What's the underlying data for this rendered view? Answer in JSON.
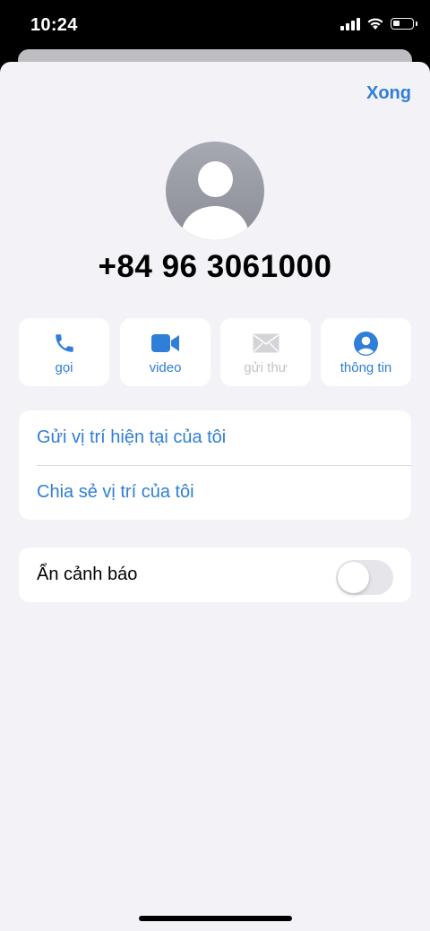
{
  "status_bar": {
    "time": "10:24"
  },
  "header": {
    "done_label": "Xong"
  },
  "contact": {
    "phone_number": "+84 96 3061000"
  },
  "actions": [
    {
      "label": "gọi",
      "icon": "phone-icon",
      "enabled": true
    },
    {
      "label": "video",
      "icon": "video-camera-icon",
      "enabled": true
    },
    {
      "label": "gửi thư",
      "icon": "mail-icon",
      "enabled": false
    },
    {
      "label": "thông tin",
      "icon": "person-circle-icon",
      "enabled": true
    }
  ],
  "location_group": [
    {
      "label": "Gửi vị trí hiện tại của tôi"
    },
    {
      "label": "Chia sẻ vị trí của tôi"
    }
  ],
  "alerts": {
    "label": "Ẩn cảnh báo",
    "toggle_on": false
  },
  "colors": {
    "accent": "#2f7ed8",
    "background": "#f2f2f7",
    "disabled": "#c4c4c8"
  }
}
